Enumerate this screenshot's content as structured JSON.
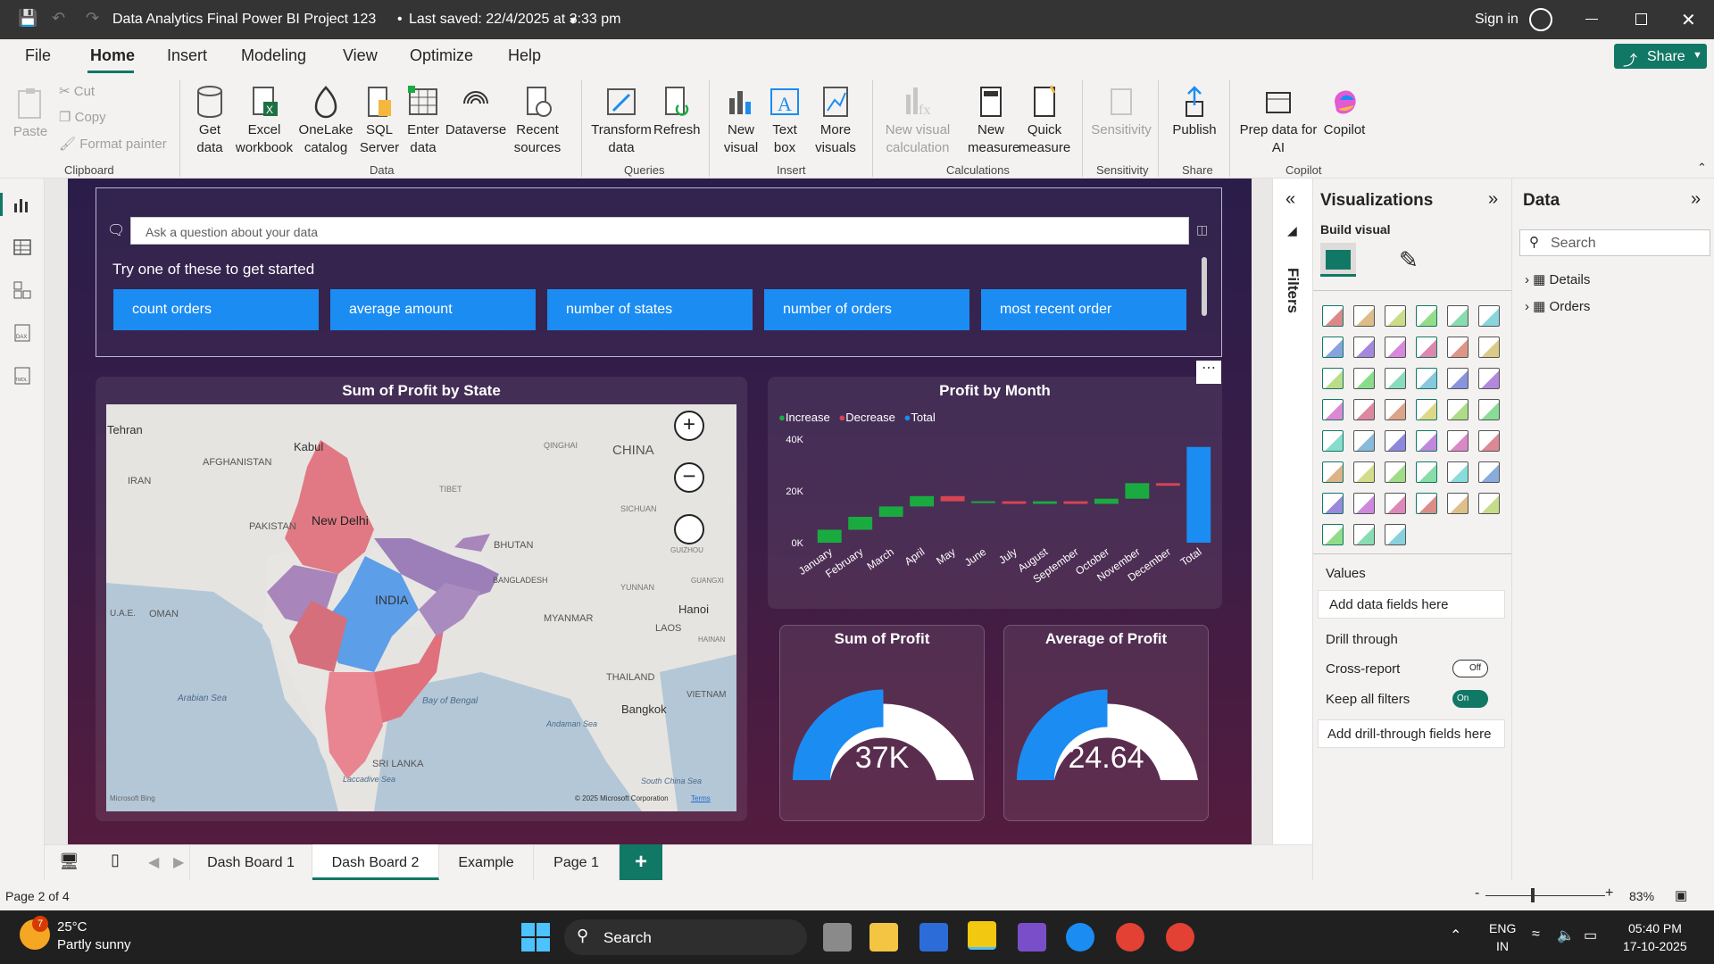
{
  "titlebar": {
    "title": "Data Analytics Final Power BI Project 123",
    "saved": "Last saved: 22/4/2025 at 3:33 pm",
    "sign_in": "Sign in"
  },
  "menu": {
    "tabs": [
      "File",
      "Home",
      "Insert",
      "Modeling",
      "View",
      "Optimize",
      "Help"
    ],
    "active": "Home",
    "share": "Share"
  },
  "ribbon": {
    "clipboard": {
      "paste": "Paste",
      "cut": "Cut",
      "copy": "Copy",
      "format_painter": "Format painter",
      "group": "Clipboard"
    },
    "data": {
      "get_data": "Get data",
      "excel": "Excel workbook",
      "onelake": "OneLake catalog",
      "sql": "SQL Server",
      "enter": "Enter data",
      "dataverse": "Dataverse",
      "recent": "Recent sources",
      "group": "Data"
    },
    "queries": {
      "transform": "Transform data",
      "refresh": "Refresh",
      "group": "Queries"
    },
    "insert": {
      "new_visual": "New visual",
      "text_box": "Text box",
      "more_visuals": "More visuals",
      "group": "Insert"
    },
    "calculations": {
      "new_visual_calc": "New visual calculation",
      "new_measure": "New measure",
      "quick_measure": "Quick measure",
      "group": "Calculations"
    },
    "sensitivity": {
      "label": "Sensitivity",
      "group": "Sensitivity"
    },
    "share": {
      "publish": "Publish",
      "group": "Share"
    },
    "copilot": {
      "prep": "Prep data for AI",
      "copilot": "Copilot",
      "group": "Copilot"
    }
  },
  "qa": {
    "placeholder": "Ask a question about your data",
    "prompt": "Try one of these to get started",
    "suggestions": [
      "count orders",
      "average amount",
      "number of states",
      "number of orders",
      "most recent order"
    ]
  },
  "map": {
    "title": "Sum of Profit by State",
    "labels": [
      "Tehran",
      "Kabul",
      "AFGHANISTAN",
      "IRAN",
      "PAKISTAN",
      "New Delhi",
      "CHINA",
      "QINGHAI",
      "TIBET",
      "SICHUAN",
      "BHUTAN",
      "INDIA",
      "BANGLADESH",
      "MYANMAR",
      "LAOS",
      "Hanoi",
      "YUNNAN",
      "GUIZHOU",
      "GUANGXI",
      "HAINAN",
      "U.A.E.",
      "OMAN",
      "Arabian Sea",
      "Bay of Bengal",
      "THAILAND",
      "Bangkok",
      "Andaman Sea",
      "VIETNAM",
      "SRI LANKA",
      "Laccadive Sea",
      "South China Sea",
      "Microsoft Bing",
      "© 2025 Microsoft Corporation",
      "Terms"
    ]
  },
  "waterfall": {
    "title": "Profit by Month",
    "legend": [
      "Increase",
      "Decrease",
      "Total"
    ],
    "colors": {
      "increase": "#1aab40",
      "decrease": "#d64554",
      "total": "#1b8cf2"
    }
  },
  "chart_data": [
    {
      "type": "bar",
      "title": "Profit by Month",
      "subtype": "waterfall",
      "categories": [
        "January",
        "February",
        "March",
        "April",
        "May",
        "June",
        "July",
        "August",
        "September",
        "October",
        "November",
        "December",
        "Total"
      ],
      "values": [
        5000,
        5000,
        4000,
        4000,
        -2000,
        0,
        -1000,
        1000,
        -1000,
        2000,
        6000,
        -1000,
        37000
      ],
      "ylim": [
        0,
        40000
      ],
      "yticks": [
        "0K",
        "20K",
        "40K"
      ],
      "legend": [
        "Increase",
        "Decrease",
        "Total"
      ]
    },
    {
      "type": "gauge",
      "title": "Sum of Profit",
      "value_label": "37K",
      "fill": 0.5
    },
    {
      "type": "gauge",
      "title": "Average of Profit",
      "value_label": "24.64",
      "fill": 0.5
    }
  ],
  "gauges": {
    "sum": {
      "title": "Sum of Profit",
      "value": "37K"
    },
    "avg": {
      "title": "Average of Profit",
      "value": "24.64"
    }
  },
  "viz_pane": {
    "title": "Visualizations",
    "build": "Build visual",
    "values": "Values",
    "add_fields": "Add data fields here",
    "drill": "Drill through",
    "cross": "Cross-report",
    "cross_state": "Off",
    "keep": "Keep all filters",
    "keep_state": "On",
    "add_drill": "Add drill-through fields here"
  },
  "filters": {
    "label": "Filters"
  },
  "data_pane": {
    "title": "Data",
    "search": "Search",
    "tables": [
      "Details",
      "Orders"
    ]
  },
  "pages": {
    "tabs": [
      "Dash Board 1",
      "Dash Board 2",
      "Example",
      "Page 1"
    ],
    "active": "Dash Board 2",
    "status": "Page 2 of 4",
    "zoom": "83%"
  },
  "taskbar": {
    "temp": "25°C",
    "weather": "Partly sunny",
    "badge": "7",
    "search": "Search",
    "lang1": "ENG",
    "lang2": "IN",
    "time": "05:40 PM",
    "date": "17-10-2025"
  }
}
